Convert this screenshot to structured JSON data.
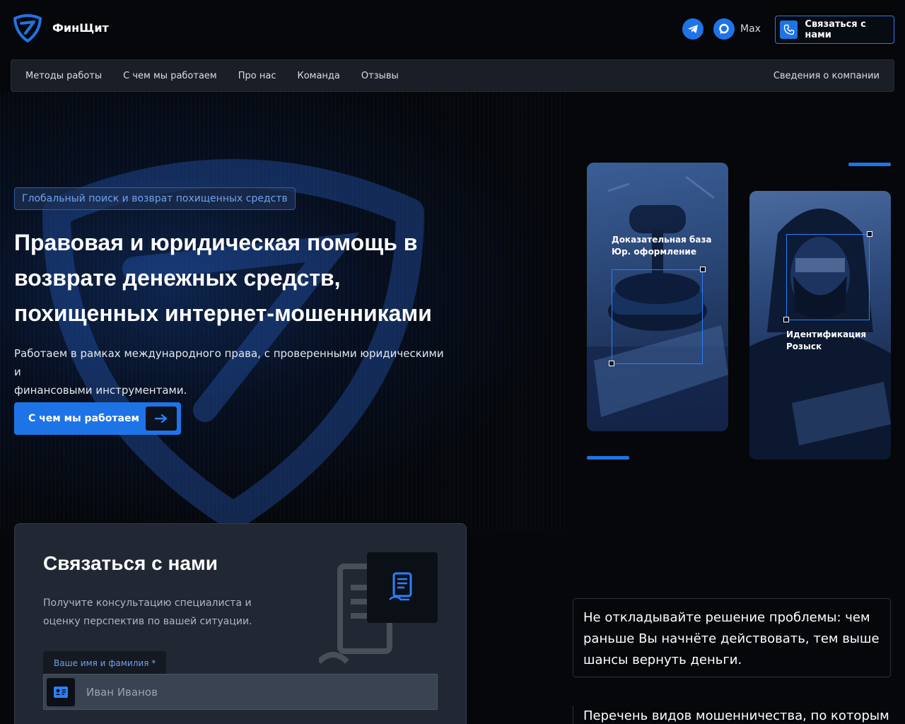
{
  "brand": {
    "name": "ФинЩит"
  },
  "header": {
    "social": [
      {
        "icon": "telegram-icon",
        "label": ""
      },
      {
        "icon": "max-messenger-icon",
        "label": "Max"
      }
    ],
    "contact_button": "Связаться с нами"
  },
  "nav": {
    "items": [
      "Методы работы",
      "С чем мы работаем",
      "Про нас",
      "Команда",
      "Отзывы"
    ],
    "right_link": "Сведения о компании"
  },
  "hero": {
    "badge": "Глобальный поиск и возврат похищенных средств",
    "title_lines": [
      "Правовая и юридическая помощь в",
      "возврате денежных средств,",
      "похищенных интернет-мошенниками"
    ],
    "subtitle_lines": [
      "Работаем в рамках международного права, с проверенными юридическими и",
      "финансовыми инструментами."
    ],
    "cta": "С чем мы работаем"
  },
  "cards": [
    {
      "caption_lines": [
        "Доказательная база",
        "Юр. оформление"
      ],
      "image": "judge-gavel"
    },
    {
      "caption_lines": [
        "Идентификация",
        "Розыск"
      ],
      "image": "hooded-hacker"
    }
  ],
  "contact_form": {
    "title": "Связаться с нами",
    "subtitle_lines": [
      "Получите консультацию специалиста и",
      "оценку перспектив по вашей ситуации."
    ],
    "name_field": {
      "label": "Ваше имя и фамилия *",
      "placeholder": "Иван Иванов",
      "value": ""
    }
  },
  "notes": {
    "note1_lines": [
      "Не откладывайте решение проблемы: чем",
      "раньше Вы начнёте действовать, тем выше",
      "шансы вернуть деньги."
    ],
    "note2": "Перечень видов мошенничества, по которым"
  },
  "colors": {
    "accent": "#1e74e6",
    "background": "#05070b",
    "nav_bg": "#1a1f27",
    "form_bg": "#212833",
    "badge_text": "#6fa2ec"
  }
}
